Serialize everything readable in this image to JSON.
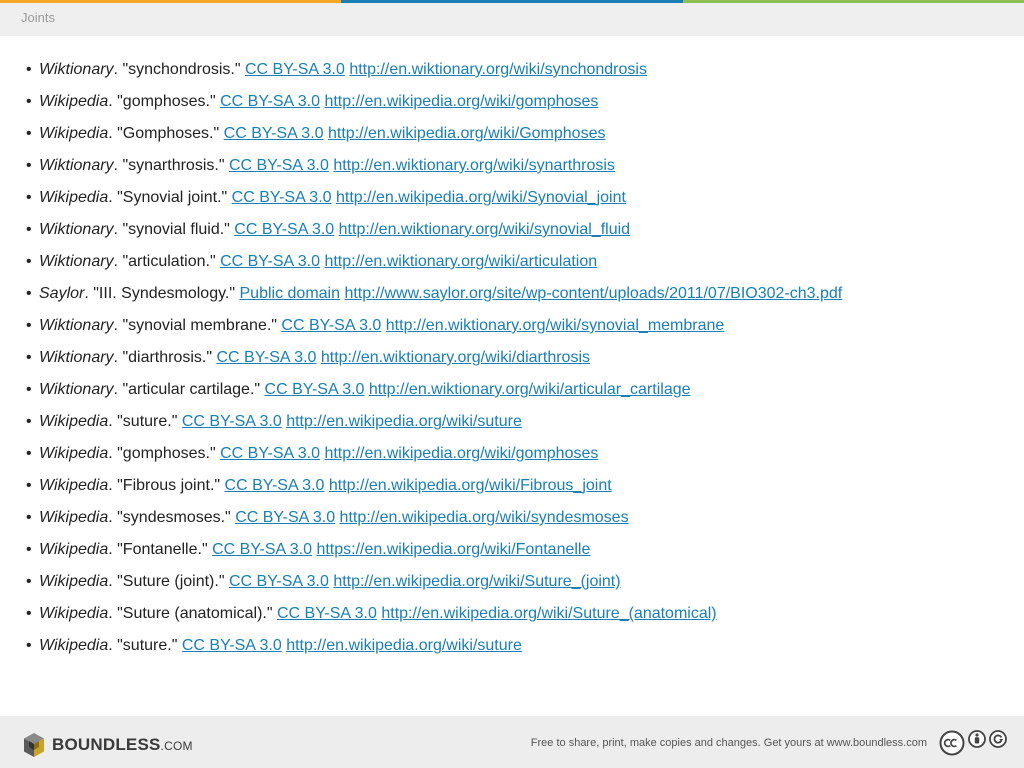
{
  "colors": {
    "bar": [
      "#f5a623",
      "#1b7fb5",
      "#8cc152"
    ],
    "link": "#1b7fb5"
  },
  "header": {
    "title": "Joints"
  },
  "references": [
    {
      "source": "Wiktionary",
      "title": "\"synchondrosis.\"",
      "license": "CC BY-SA 3.0",
      "url": "http://en.wiktionary.org/wiki/synchondrosis"
    },
    {
      "source": "Wikipedia",
      "title": "\"gomphoses.\"",
      "license": "CC BY-SA 3.0",
      "url": "http://en.wikipedia.org/wiki/gomphoses"
    },
    {
      "source": "Wikipedia",
      "title": "\"Gomphoses.\"",
      "license": "CC BY-SA 3.0",
      "url": "http://en.wikipedia.org/wiki/Gomphoses"
    },
    {
      "source": "Wiktionary",
      "title": "\"synarthrosis.\"",
      "license": "CC BY-SA 3.0",
      "url": "http://en.wiktionary.org/wiki/synarthrosis"
    },
    {
      "source": "Wikipedia",
      "title": "\"Synovial joint.\"",
      "license": "CC BY-SA 3.0",
      "url": "http://en.wikipedia.org/wiki/Synovial_joint"
    },
    {
      "source": "Wiktionary",
      "title": "\"synovial fluid.\"",
      "license": "CC BY-SA 3.0",
      "url": "http://en.wiktionary.org/wiki/synovial_fluid"
    },
    {
      "source": "Wiktionary",
      "title": "\"articulation.\"",
      "license": "CC BY-SA 3.0",
      "url": "http://en.wiktionary.org/wiki/articulation"
    },
    {
      "source": "Saylor",
      "title": "\"III. Syndesmology.\"",
      "license": "Public domain",
      "url": "http://www.saylor.org/site/wp-content/uploads/2011/07/BIO302-ch3.pdf"
    },
    {
      "source": "Wiktionary",
      "title": "\"synovial membrane.\"",
      "license": "CC BY-SA 3.0",
      "url": "http://en.wiktionary.org/wiki/synovial_membrane"
    },
    {
      "source": "Wiktionary",
      "title": "\"diarthrosis.\"",
      "license": "CC BY-SA 3.0",
      "url": "http://en.wiktionary.org/wiki/diarthrosis"
    },
    {
      "source": "Wiktionary",
      "title": "\"articular cartilage.\"",
      "license": "CC BY-SA 3.0",
      "url": "http://en.wiktionary.org/wiki/articular_cartilage"
    },
    {
      "source": "Wikipedia",
      "title": "\"suture.\"",
      "license": "CC BY-SA 3.0",
      "url": "http://en.wikipedia.org/wiki/suture"
    },
    {
      "source": "Wikipedia",
      "title": "\"gomphoses.\"",
      "license": "CC BY-SA 3.0",
      "url": "http://en.wikipedia.org/wiki/gomphoses"
    },
    {
      "source": "Wikipedia",
      "title": "\"Fibrous joint.\"",
      "license": "CC BY-SA 3.0",
      "url": "http://en.wikipedia.org/wiki/Fibrous_joint"
    },
    {
      "source": "Wikipedia",
      "title": "\"syndesmoses.\"",
      "license": "CC BY-SA 3.0",
      "url": "http://en.wikipedia.org/wiki/syndesmoses"
    },
    {
      "source": "Wikipedia",
      "title": "\"Fontanelle.\"",
      "license": "CC BY-SA 3.0",
      "url": "https://en.wikipedia.org/wiki/Fontanelle"
    },
    {
      "source": "Wikipedia",
      "title": "\"Suture (joint).\"",
      "license": "CC BY-SA 3.0",
      "url": "http://en.wikipedia.org/wiki/Suture_(joint)"
    },
    {
      "source": "Wikipedia",
      "title": "\"Suture (anatomical).\"",
      "license": "CC BY-SA 3.0",
      "url": "http://en.wikipedia.org/wiki/Suture_(anatomical)"
    },
    {
      "source": "Wikipedia",
      "title": "\"suture.\"",
      "license": "CC BY-SA 3.0",
      "url": "http://en.wikipedia.org/wiki/suture"
    }
  ],
  "footer": {
    "logo_main": "BOUNDLESS",
    "logo_suffix": ".COM",
    "note": "Free to share, print, make copies and changes. Get yours at www.boundless.com",
    "license_icons": [
      "cc-icon",
      "by-icon",
      "sa-icon"
    ]
  }
}
